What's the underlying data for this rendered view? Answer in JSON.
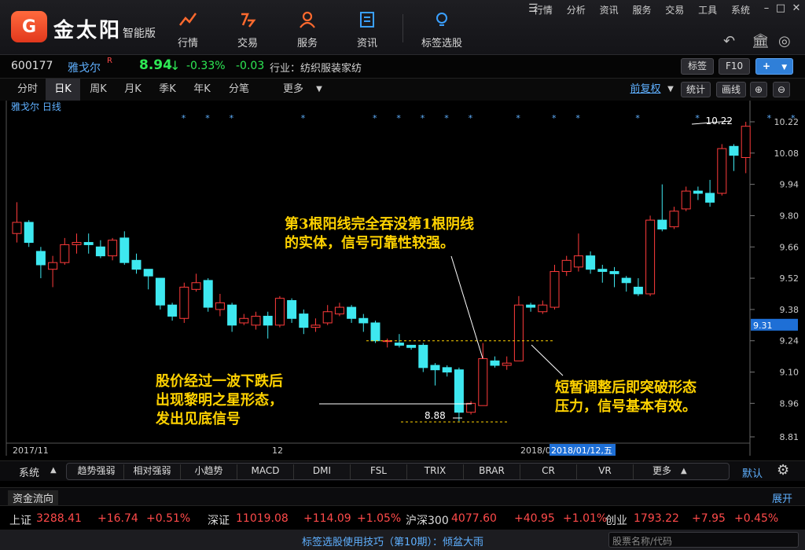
{
  "app": {
    "logo_glyph": "G",
    "brand": "金太阳",
    "edition": "智能版",
    "nav": [
      {
        "label": "行情",
        "icon": "trend-icon"
      },
      {
        "label": "交易",
        "icon": "trade-icon"
      },
      {
        "label": "服务",
        "icon": "user-icon"
      },
      {
        "label": "资讯",
        "icon": "news-icon"
      },
      {
        "label": "标签选股",
        "icon": "bulb-icon"
      }
    ],
    "menu": [
      "行情",
      "分析",
      "资讯",
      "服务",
      "交易",
      "工具",
      "系统"
    ]
  },
  "quote": {
    "code": "600177",
    "name": "雅戈尔",
    "name_mark": "R",
    "price": "8.94",
    "arrow": "↓",
    "pct": "-0.33%",
    "change": "-0.03",
    "industry": "行业：纺织服装家纺",
    "btn_tag": "标签",
    "btn_f10": "F10",
    "btn_add": "+"
  },
  "periods": {
    "items": [
      "分时",
      "日K",
      "周K",
      "月K",
      "季K",
      "年K",
      "分笔"
    ],
    "active": "日K",
    "more": "更多",
    "adjust": "前复权",
    "stats": "统计",
    "draw": "画线"
  },
  "chart_data": {
    "type": "candlestick",
    "title": "雅戈尔  日线",
    "y_ticks": [
      10.22,
      10.08,
      9.94,
      9.8,
      9.66,
      9.52,
      9.38,
      9.24,
      9.1,
      8.96,
      8.81
    ],
    "ylim": [
      8.81,
      10.22
    ],
    "current_price_label": "9.31",
    "high_label": "10.22",
    "low_label": "8.88",
    "x_labels": [
      "2017/11",
      "12",
      "2018/0"
    ],
    "crosshair_date": "2018/01/12,五",
    "colors": {
      "up": "#ff3b3b",
      "down": "#3ee8f0",
      "note": "#ffd200",
      "bg": "#000000"
    },
    "candles": [
      {
        "o": 9.72,
        "h": 9.86,
        "l": 9.68,
        "c": 9.77
      },
      {
        "o": 9.77,
        "h": 9.78,
        "l": 9.66,
        "c": 9.68
      },
      {
        "o": 9.64,
        "h": 9.66,
        "l": 9.52,
        "c": 9.58
      },
      {
        "o": 9.56,
        "h": 9.62,
        "l": 9.48,
        "c": 9.59
      },
      {
        "o": 9.59,
        "h": 9.7,
        "l": 9.58,
        "c": 9.67
      },
      {
        "o": 9.67,
        "h": 9.72,
        "l": 9.63,
        "c": 9.68
      },
      {
        "o": 9.68,
        "h": 9.72,
        "l": 9.63,
        "c": 9.67
      },
      {
        "o": 9.66,
        "h": 9.69,
        "l": 9.61,
        "c": 9.62
      },
      {
        "o": 9.62,
        "h": 9.7,
        "l": 9.6,
        "c": 9.69
      },
      {
        "o": 9.7,
        "h": 9.73,
        "l": 9.58,
        "c": 9.59
      },
      {
        "o": 9.6,
        "h": 9.63,
        "l": 9.54,
        "c": 9.56
      },
      {
        "o": 9.56,
        "h": 9.56,
        "l": 9.47,
        "c": 9.53
      },
      {
        "o": 9.52,
        "h": 9.52,
        "l": 9.38,
        "c": 9.4
      },
      {
        "o": 9.4,
        "h": 9.41,
        "l": 9.33,
        "c": 9.35
      },
      {
        "o": 9.34,
        "h": 9.5,
        "l": 9.32,
        "c": 9.48
      },
      {
        "o": 9.47,
        "h": 9.54,
        "l": 9.46,
        "c": 9.5
      },
      {
        "o": 9.51,
        "h": 9.52,
        "l": 9.37,
        "c": 9.39
      },
      {
        "o": 9.38,
        "h": 9.45,
        "l": 9.35,
        "c": 9.41
      },
      {
        "o": 9.4,
        "h": 9.41,
        "l": 9.28,
        "c": 9.31
      },
      {
        "o": 9.32,
        "h": 9.36,
        "l": 9.31,
        "c": 9.34
      },
      {
        "o": 9.31,
        "h": 9.37,
        "l": 9.29,
        "c": 9.35
      },
      {
        "o": 9.35,
        "h": 9.37,
        "l": 9.25,
        "c": 9.31
      },
      {
        "o": 9.31,
        "h": 9.44,
        "l": 9.3,
        "c": 9.43
      },
      {
        "o": 9.42,
        "h": 9.43,
        "l": 9.32,
        "c": 9.34
      },
      {
        "o": 9.36,
        "h": 9.38,
        "l": 9.27,
        "c": 9.3
      },
      {
        "o": 9.3,
        "h": 9.34,
        "l": 9.28,
        "c": 9.31
      },
      {
        "o": 9.32,
        "h": 9.4,
        "l": 9.31,
        "c": 9.37
      },
      {
        "o": 9.36,
        "h": 9.41,
        "l": 9.35,
        "c": 9.39
      },
      {
        "o": 9.39,
        "h": 9.4,
        "l": 9.32,
        "c": 9.34
      },
      {
        "o": 9.34,
        "h": 9.36,
        "l": 9.28,
        "c": 9.32
      },
      {
        "o": 9.32,
        "h": 9.33,
        "l": 9.23,
        "c": 9.24
      },
      {
        "o": 9.24,
        "h": 9.25,
        "l": 9.21,
        "c": 9.24
      },
      {
        "o": 9.23,
        "h": 9.27,
        "l": 9.21,
        "c": 9.22
      },
      {
        "o": 9.22,
        "h": 9.22,
        "l": 9.2,
        "c": 9.21
      },
      {
        "o": 9.22,
        "h": 9.23,
        "l": 9.1,
        "c": 9.12
      },
      {
        "o": 9.13,
        "h": 9.14,
        "l": 9.04,
        "c": 9.11
      },
      {
        "o": 9.12,
        "h": 9.13,
        "l": 9.08,
        "c": 9.1
      },
      {
        "o": 9.11,
        "h": 9.12,
        "l": 8.88,
        "c": 8.92
      },
      {
        "o": 8.92,
        "h": 8.97,
        "l": 8.91,
        "c": 8.96
      },
      {
        "o": 8.95,
        "h": 9.23,
        "l": 8.95,
        "c": 9.16
      },
      {
        "o": 9.15,
        "h": 9.17,
        "l": 9.12,
        "c": 9.13
      },
      {
        "o": 9.13,
        "h": 9.17,
        "l": 9.11,
        "c": 9.14
      },
      {
        "o": 9.15,
        "h": 9.44,
        "l": 9.15,
        "c": 9.4
      },
      {
        "o": 9.4,
        "h": 9.41,
        "l": 9.37,
        "c": 9.39
      },
      {
        "o": 9.37,
        "h": 9.42,
        "l": 9.36,
        "c": 9.4
      },
      {
        "o": 9.39,
        "h": 9.58,
        "l": 9.38,
        "c": 9.55
      },
      {
        "o": 9.55,
        "h": 9.62,
        "l": 9.53,
        "c": 9.6
      },
      {
        "o": 9.57,
        "h": 9.72,
        "l": 9.55,
        "c": 9.62
      },
      {
        "o": 9.62,
        "h": 9.64,
        "l": 9.54,
        "c": 9.56
      },
      {
        "o": 9.56,
        "h": 9.58,
        "l": 9.5,
        "c": 9.55
      },
      {
        "o": 9.55,
        "h": 9.57,
        "l": 9.48,
        "c": 9.54
      },
      {
        "o": 9.52,
        "h": 9.53,
        "l": 9.46,
        "c": 9.5
      },
      {
        "o": 9.48,
        "h": 9.52,
        "l": 9.44,
        "c": 9.45
      },
      {
        "o": 9.45,
        "h": 9.8,
        "l": 9.44,
        "c": 9.78
      },
      {
        "o": 9.78,
        "h": 9.94,
        "l": 9.73,
        "c": 9.74
      },
      {
        "o": 9.75,
        "h": 9.84,
        "l": 9.74,
        "c": 9.82
      },
      {
        "o": 9.83,
        "h": 9.93,
        "l": 9.82,
        "c": 9.91
      },
      {
        "o": 9.91,
        "h": 9.93,
        "l": 9.87,
        "c": 9.9
      },
      {
        "o": 9.9,
        "h": 9.96,
        "l": 9.84,
        "c": 9.86
      },
      {
        "o": 9.9,
        "h": 10.12,
        "l": 9.89,
        "c": 10.1
      },
      {
        "o": 10.11,
        "h": 10.12,
        "l": 10.0,
        "c": 10.07
      },
      {
        "o": 10.06,
        "h": 10.22,
        "l": 9.99,
        "c": 10.2
      }
    ],
    "event_stars": [
      14,
      16,
      18,
      24,
      30,
      32,
      34,
      36,
      38,
      42,
      45,
      47,
      52,
      57,
      63,
      65,
      72,
      76,
      85,
      89
    ]
  },
  "annotations": {
    "note1": [
      "第3根阳线完全吞没第1根阴线",
      "的实体，信号可靠性较强。"
    ],
    "note2": [
      "股价经过一波下跌后",
      "出现黎明之星形态，",
      "发出见底信号"
    ],
    "note3": [
      "短暂调整后即突破形态",
      "压力，信号基本有效。"
    ]
  },
  "indicators": {
    "system_label": "系统",
    "tabs": [
      "趋势强弱",
      "相对强弱",
      "小趋势",
      "MACD",
      "DMI",
      "FSL",
      "TRIX",
      "BRAR",
      "CR",
      "VR",
      "更多"
    ],
    "default_label": "默认"
  },
  "fund": {
    "label": "资金流向",
    "expand": "展开"
  },
  "indices": [
    {
      "name": "上证",
      "value": "3288.41",
      "chg": "+16.74",
      "pct": "+0.51%"
    },
    {
      "name": "深证",
      "value": "11019.08",
      "chg": "+114.09",
      "pct": "+1.05%"
    },
    {
      "name": "沪深300",
      "value": "4077.60",
      "chg": "+40.95",
      "pct": "+1.01%"
    },
    {
      "name": "创业",
      "value": "1793.22",
      "chg": "+7.95",
      "pct": "+0.45%"
    }
  ],
  "status": {
    "tip": "标签选股使用技巧（第10期）：倾盆大雨",
    "search_placeholder": "股票名称/代码"
  }
}
